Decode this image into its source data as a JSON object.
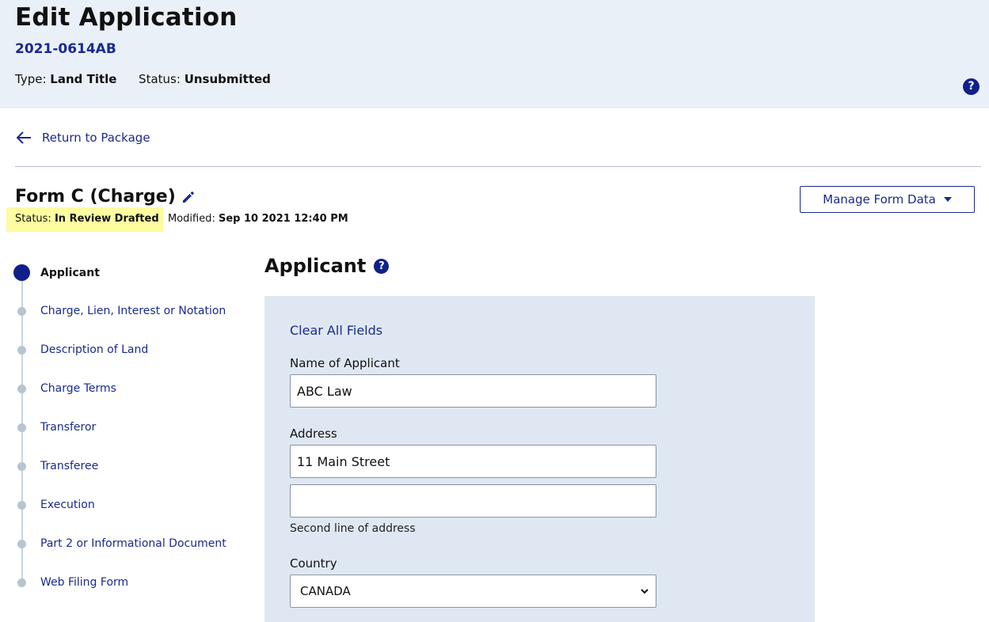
{
  "header": {
    "title": "Edit Application",
    "application_number": "2021-0614AB",
    "type_label": "Type:",
    "type_value": "Land Title",
    "status_label": "Status:",
    "status_value": "Unsubmitted",
    "help_glyph": "?"
  },
  "nav": {
    "return_label": "Return to Package"
  },
  "form": {
    "title": "Form C (Charge)",
    "status_label": "Status:",
    "status_value": "In Review Drafted",
    "modified_label": "Modified:",
    "modified_value": "Sep 10 2021 12:40 PM",
    "manage_button_label": "Manage Form Data"
  },
  "steps": [
    {
      "label": "Applicant",
      "active": true
    },
    {
      "label": "Charge, Lien, Interest or Notation",
      "active": false
    },
    {
      "label": "Description of Land",
      "active": false
    },
    {
      "label": "Charge Terms",
      "active": false
    },
    {
      "label": "Transferor",
      "active": false
    },
    {
      "label": "Transferee",
      "active": false
    },
    {
      "label": "Execution",
      "active": false
    },
    {
      "label": "Part 2 or Informational Document",
      "active": false
    },
    {
      "label": "Web Filing Form",
      "active": false
    }
  ],
  "section": {
    "title": "Applicant",
    "help_glyph": "?",
    "clear_link": "Clear All Fields",
    "name_label": "Name of Applicant",
    "name_value": "ABC Law",
    "address_label": "Address",
    "address_line1_value": "11 Main Street",
    "address_line2_value": "",
    "address_hint": "Second line of address",
    "country_label": "Country",
    "country_value": "CANADA"
  },
  "colors": {
    "accent": "#1a2a8e",
    "header_bg": "#eaf0f8",
    "panel_bg": "#dfe8f2",
    "highlight": "#fdfca0"
  }
}
